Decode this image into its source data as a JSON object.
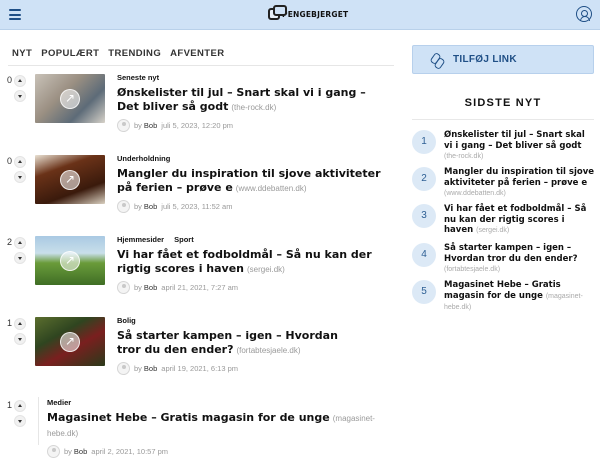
{
  "header": {
    "logo_text": "PENGEBJERGET",
    "icons": [
      "menu-icon",
      "user-icon"
    ]
  },
  "tabs": [
    "NYT",
    "POPULÆRT",
    "TRENDING",
    "AFVENTER"
  ],
  "feed": [
    {
      "votes": "0",
      "categories": [
        "Seneste nyt"
      ],
      "title": "Ønskelister til jul – Snart skal vi i gang – Det bliver så godt",
      "domain": "(the-rock.dk)",
      "by": "by",
      "author": "Bob",
      "date": "juli 5, 2023, 12:20 pm",
      "has_image": true
    },
    {
      "votes": "0",
      "categories": [
        "Underholdning"
      ],
      "title": "Mangler du inspiration til sjove aktiviteter på ferien – prøve e",
      "domain": "(www.ddebatten.dk)",
      "by": "by",
      "author": "Bob",
      "date": "juli 5, 2023, 11:52 am",
      "has_image": true
    },
    {
      "votes": "2",
      "categories": [
        "Hjemmesider",
        "Sport"
      ],
      "title": "Vi har fået et fodboldmål – Så nu kan der rigtig scores i haven",
      "domain": "(sergei.dk)",
      "by": "by",
      "author": "Bob",
      "date": "april 21, 2021, 7:27 am",
      "has_image": true
    },
    {
      "votes": "1",
      "categories": [
        "Bolig"
      ],
      "title": "Så starter kampen – igen – Hvordan tror du den ender?",
      "domain": "(fortabtesjaele.dk)",
      "by": "by",
      "author": "Bob",
      "date": "april 19, 2021, 6:13 pm",
      "has_image": true
    },
    {
      "votes": "1",
      "categories": [
        "Medier"
      ],
      "title": "Magasinet Hebe – Gratis magasin for de unge",
      "domain": "(magasinet-hebe.dk)",
      "by": "by",
      "author": "Bob",
      "date": "april 2, 2021, 10:57 pm",
      "has_image": false
    }
  ],
  "sidebar": {
    "add_link_label": "TILFØJ LINK",
    "heading": "SIDSTE NYT",
    "items": [
      {
        "num": "1",
        "title": "Ønskelister til jul – Snart skal vi i gang – Det bliver så godt",
        "domain": "(the-rock.dk)"
      },
      {
        "num": "2",
        "title": "Mangler du inspiration til sjove aktiviteter på ferien – prøve e",
        "domain": "(www.ddebatten.dk)"
      },
      {
        "num": "3",
        "title": "Vi har fået et fodboldmål – Så nu kan der rigtig scores i haven",
        "domain": "(sergei.dk)"
      },
      {
        "num": "4",
        "title": "Så starter kampen – igen – Hvordan tror du den ender?",
        "domain": "(fortabtesjaele.dk)"
      },
      {
        "num": "5",
        "title": "Magasinet Hebe – Gratis magasin for de unge",
        "domain": "(magasinet-hebe.dk)"
      }
    ]
  }
}
